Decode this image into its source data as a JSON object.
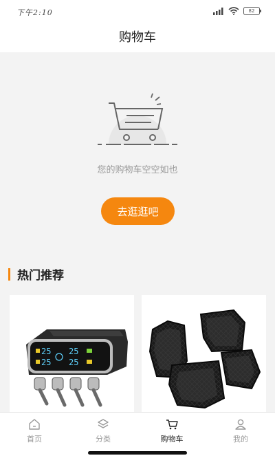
{
  "status_bar": {
    "time": "下午2:10",
    "battery": "82"
  },
  "header": {
    "title": "购物车"
  },
  "cart": {
    "empty_message": "您的购物车空空如也",
    "go_shopping_label": "去逛逛吧"
  },
  "recommend": {
    "title": "热门推荐",
    "products": [
      {
        "icon": "tire-pressure-monitor-image"
      },
      {
        "icon": "car-floor-mat-image"
      }
    ]
  },
  "tab_bar": {
    "items": [
      {
        "label": "首页",
        "icon": "home-icon",
        "active": false
      },
      {
        "label": "分类",
        "icon": "category-icon",
        "active": false
      },
      {
        "label": "购物车",
        "icon": "cart-icon",
        "active": true
      },
      {
        "label": "我的",
        "icon": "profile-icon",
        "active": false
      }
    ]
  },
  "colors": {
    "accent": "#f5870f",
    "background": "#f3f3f3"
  }
}
